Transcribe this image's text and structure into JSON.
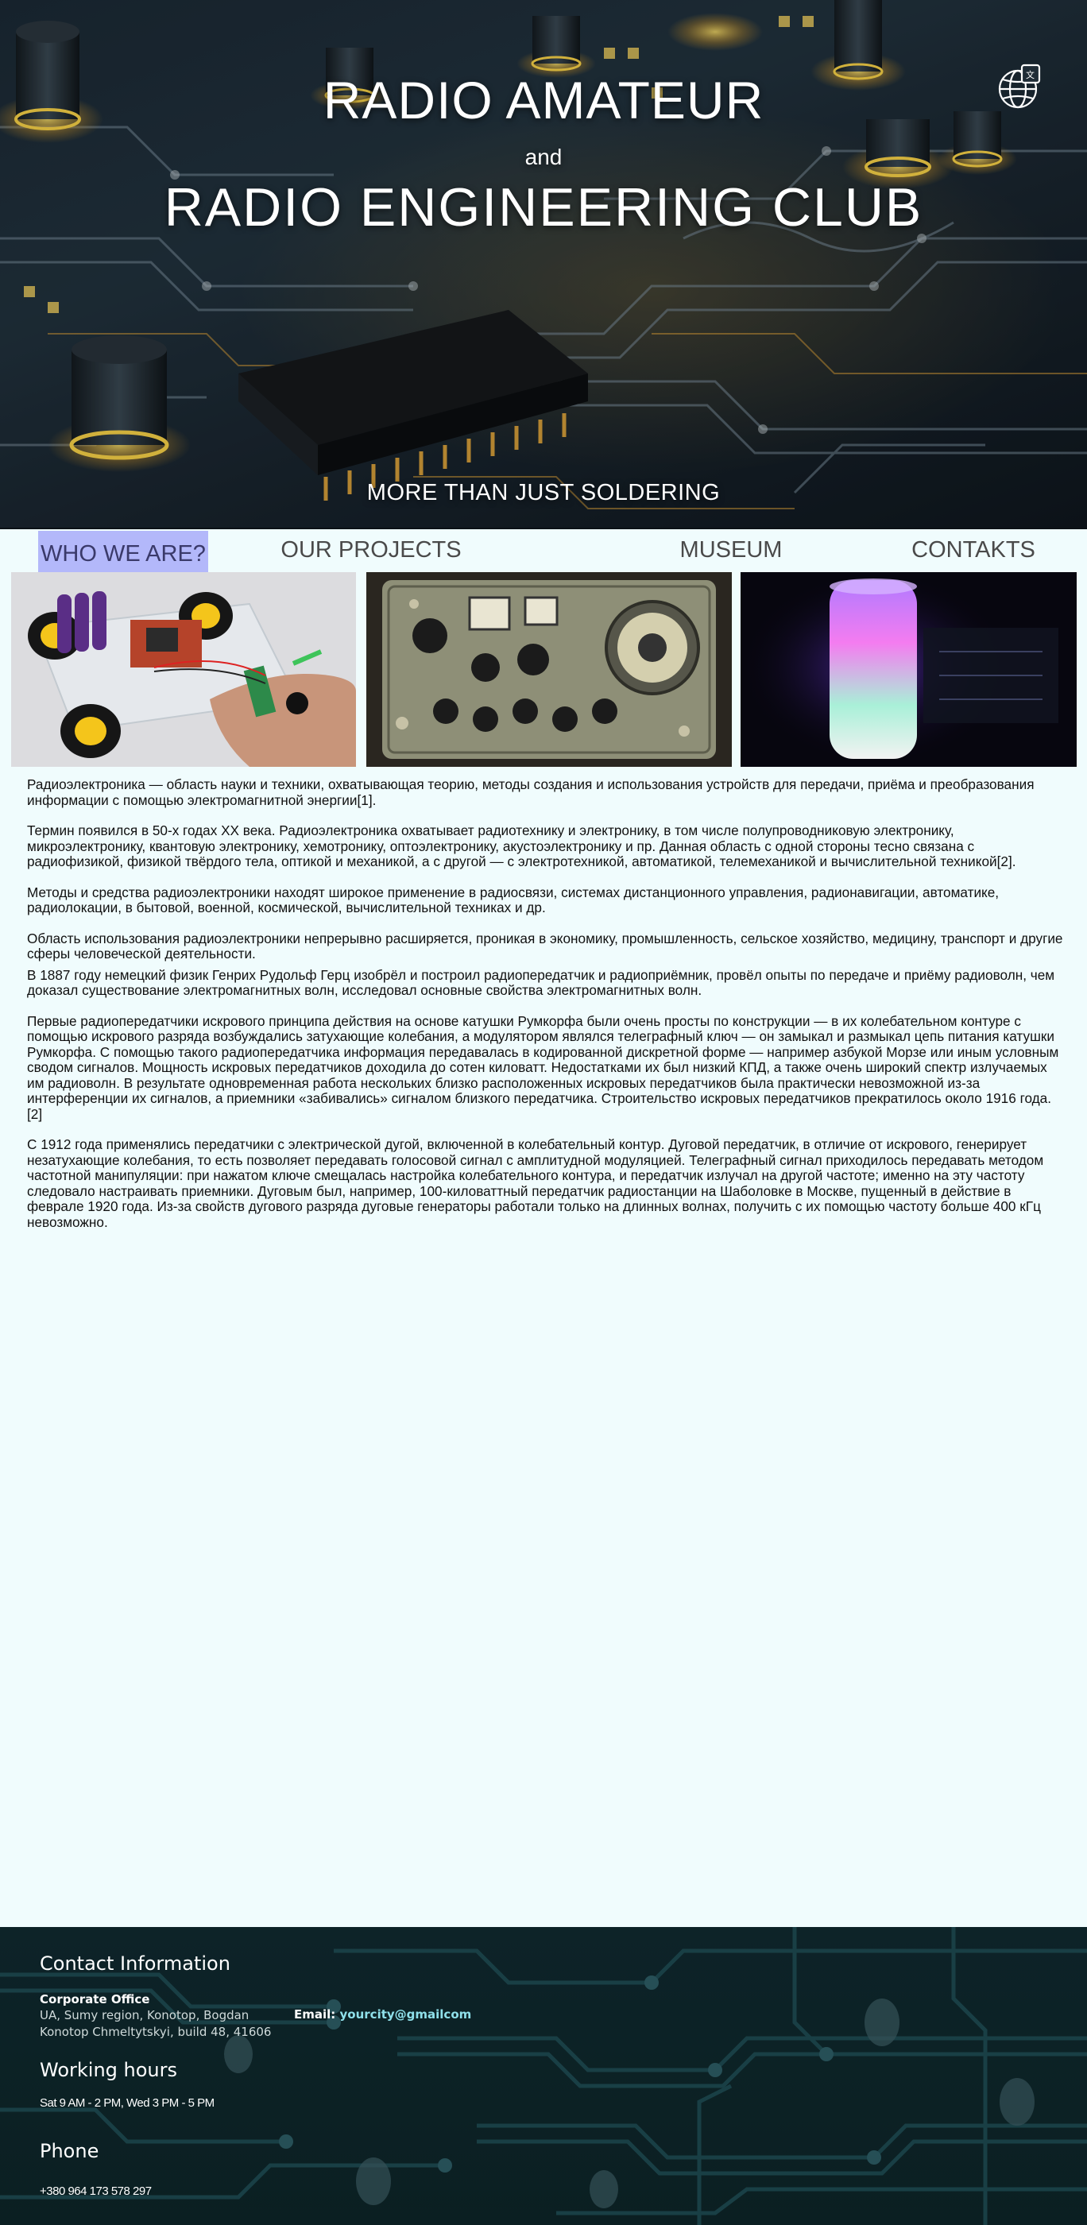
{
  "hero": {
    "title_line1": "RADIO AMATEUR",
    "title_and": "and",
    "title_line2": "RADIO ENGINEERING CLUB",
    "tagline": "MORE THAN JUST SOLDERING",
    "language_icon": "globe-translate-icon"
  },
  "nav": {
    "items": [
      {
        "label": "WHO WE ARE?",
        "active": true
      },
      {
        "label": "OUR PROJECTS",
        "active": false
      },
      {
        "label": "MUSEUM",
        "active": false
      },
      {
        "label": "CONTAKTS",
        "active": false
      }
    ]
  },
  "article": {
    "paragraphs": [
      "Радиоэлектроника — область науки и техники, охватывающая теорию, методы создания и использования устройств для передачи, приёма и преобразования информации с помощью электромагнитной энергии[1].",
      "Термин появился в 50-х годах XX века. Радиоэлектроника охватывает радиотехнику и электронику, в том числе полупроводниковую электронику, микроэлектронику, квантовую электронику, хемотронику, оптоэлектронику, акустоэлектронику и пр. Данная область с одной стороны тесно связана с радиофизикой, физикой твёрдого тела, оптикой и механикой, а с другой — с электротехникой, автоматикой, телемеханикой и вычислительной техникой[2].",
      "Методы и средства радиоэлектроники находят широкое применение в радиосвязи, системах дистанционного управления, радионавигации, автоматике, радиолокации, в бытовой, военной, космической, вычислительной техниках и др.",
      "Область использования радиоэлектроники непрерывно расширяется, проникая в экономику, промышленность, сельское хозяйство, медицину, транспорт и другие сферы человеческой деятельности.",
      "В 1887 году немецкий физик Генрих Рудольф Герц изобрёл и построил радиопередатчик и радиоприёмник, провёл опыты по передаче и приёму радиоволн, чем доказал существование электромагнитных волн, исследовал основные свойства электромагнитных волн.",
      "Первые радиопередатчики искрового принципа действия на основе катушки Румкорфа были очень просты по конструкции — в их колебательном контуре с помощью искрового разряда возбуждались затухающие колебания, а модулятором являлся телеграфный ключ — он замыкал и размыкал цепь питания катушки Румкорфа. С помощью такого радиопередатчика информация передавалась в кодированной дискретной форме — например азбукой Морзе или иным условным сводом сигналов. Мощность искровых передатчиков доходила до сотен киловатт. Недостатками их был низкий КПД, а также очень широкий спектр излучаемых им радиоволн. В результате одновременная работа нескольких близко расположенных искровых передатчиков была практически невозможной из-за интерференции их сигналов, а приемники «забивались» сигналом близкого передатчика. Строительство искровых передатчиков прекратилось около 1916 года. [2]",
      "С 1912 года применялись передатчики с электрической дугой, включенной в колебательный контур. Дуговой передатчик, в отличие от искрового, генерирует незатухающие колебания, то есть позволяет передавать голосовой сигнал с амплитудной модуляцией. Телеграфный сигнал приходилось передавать методом частотной манипуляции: при нажатом ключе смещалась настройка колебательного контура, и передатчик излучал на другой частоте; именно на эту частоту следовало настраивать приемники. Дуговым был, например, 100-киловаттный передатчик радиостанции на Шаболовке в Москве, пущенный в действие в феврале 1920 года. Из-за свойств дугового разряда дуговые генераторы работали только на длинных волнах, получить с их помощью частоту больше 400 кГц невозможно."
    ]
  },
  "footer": {
    "contact_heading": "Contact Information",
    "office_label": "Corporate Office",
    "address": "UA, Sumy region, Konotop, Bogdan Konotop Chmeltytskyi, build 48, 41606",
    "email_label": "Email:",
    "email_value": "yourcity@gmailcom",
    "hours_heading": "Working hours",
    "hours_value": "Sat 9 AM - 2 PM, Wed 3 PM - 5 PM",
    "phone_heading": "Phone",
    "phone_value": "+380 964 173 578 297"
  },
  "colors": {
    "page_bg": "#f0fcfd",
    "nav_active_bg": "#b3b8fa",
    "footer_bg": "#102a2f",
    "email_accent": "#8fe0ea"
  }
}
